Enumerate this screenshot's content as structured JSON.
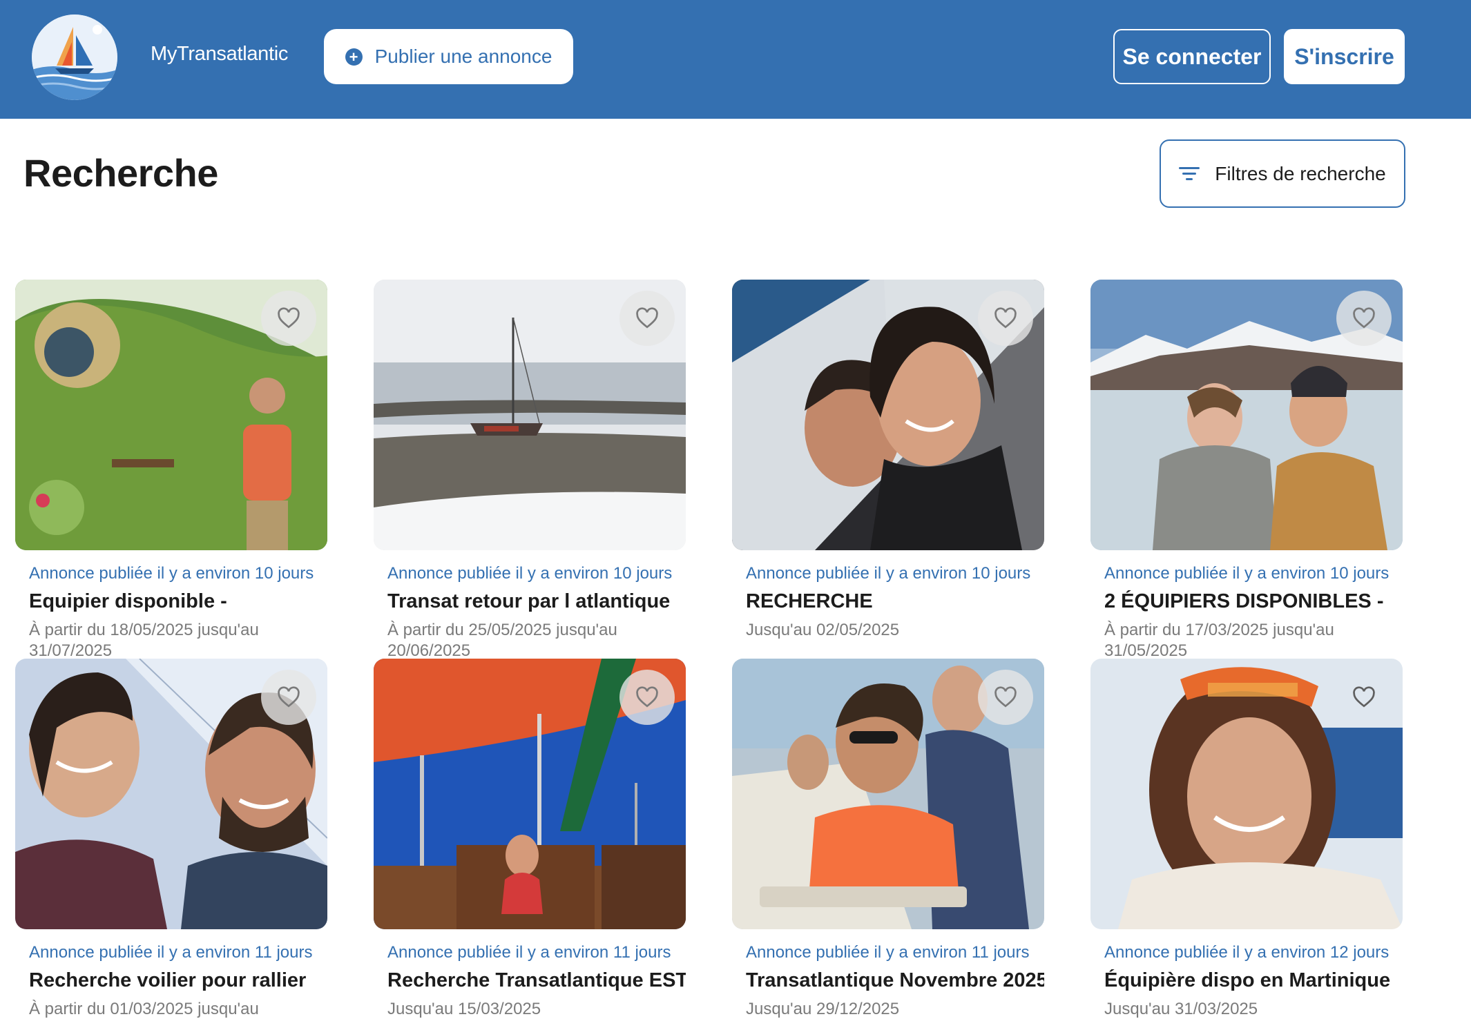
{
  "header": {
    "app_name": "MyTransatlantic",
    "publish_label": "Publier une annonce",
    "login_label": "Se connecter",
    "signup_label": "S'inscrire",
    "brand_color": "#3470b1"
  },
  "page": {
    "title": "Recherche",
    "filters_label": "Filtres de recherche"
  },
  "listings": [
    {
      "posted": "Annonce publiée il y a environ 10 jours",
      "title": "Equipier disponible -",
      "dates": "À partir du 18/05/2025 jusqu'au 31/07/2025"
    },
    {
      "posted": "Annonce publiée il y a environ 10 jours",
      "title": "Transat retour par l atlantique",
      "dates": "À partir du 25/05/2025 jusqu'au 20/06/2025"
    },
    {
      "posted": "Annonce publiée il y a environ 10 jours",
      "title": "RECHERCHE",
      "dates": "Jusqu'au 02/05/2025"
    },
    {
      "posted": "Annonce publiée il y a environ 10 jours",
      "title": "2 ÉQUIPIERS DISPONIBLES -",
      "dates": "À partir du 17/03/2025 jusqu'au 31/05/2025"
    },
    {
      "posted": "Annonce publiée il y a environ 11 jours",
      "title": "Recherche voilier pour rallier",
      "dates": "À partir du 01/03/2025 jusqu'au"
    },
    {
      "posted": "Annonce publiée il y a environ 11 jours",
      "title": "Recherche Transatlantique EST-",
      "dates": "Jusqu'au 15/03/2025"
    },
    {
      "posted": "Annonce publiée il y a environ 11 jours",
      "title": "Transatlantique Novembre 2025",
      "dates": "Jusqu'au 29/12/2025"
    },
    {
      "posted": "Annonce publiée il y a environ 12 jours",
      "title": "Équipière dispo en Martinique",
      "dates": "Jusqu'au 31/03/2025"
    }
  ]
}
